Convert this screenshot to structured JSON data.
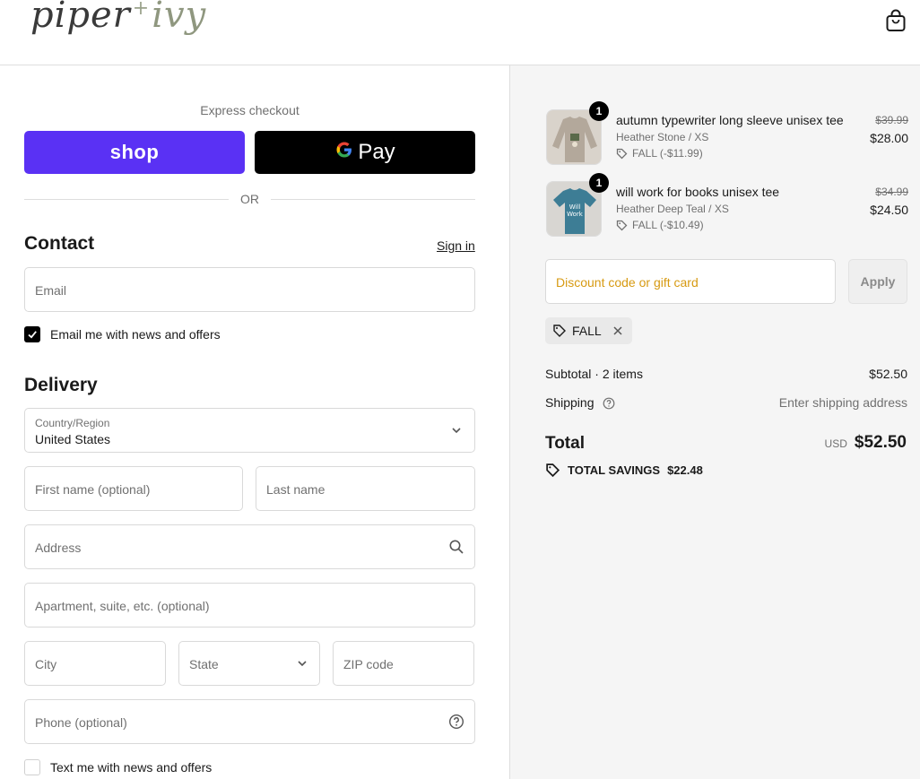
{
  "header": {
    "logo_main": "piper",
    "logo_plus": "+",
    "logo_second": "ivy",
    "cart_icon": "shopping-bag-icon"
  },
  "express": {
    "label": "Express checkout",
    "shop_label": "shop",
    "gpay_g": "G",
    "gpay_label": "Pay",
    "or_label": "OR"
  },
  "contact": {
    "title": "Contact",
    "sign_in": "Sign in",
    "email_placeholder": "Email",
    "newsletter_label": "Email me with news and offers",
    "newsletter_checked": true
  },
  "delivery": {
    "title": "Delivery",
    "country_label": "Country/Region",
    "country_value": "United States",
    "first_name_placeholder": "First name (optional)",
    "last_name_placeholder": "Last name",
    "address_placeholder": "Address",
    "apartment_placeholder": "Apartment, suite, etc. (optional)",
    "city_placeholder": "City",
    "state_placeholder": "State",
    "zip_placeholder": "ZIP code",
    "phone_placeholder": "Phone (optional)",
    "sms_label": "Text me with news and offers",
    "sms_checked": false
  },
  "order": {
    "items": [
      {
        "quantity": "1",
        "title": "autumn typewriter long sleeve unisex tee",
        "variant": "Heather Stone / XS",
        "discount": "FALL (-$11.99)",
        "original_price": "$39.99",
        "price": "$28.00",
        "color": "#b3a89b"
      },
      {
        "quantity": "1",
        "title": "will work for books unisex tee",
        "variant": "Heather Deep Teal / XS",
        "discount": "FALL (-$10.49)",
        "original_price": "$34.99",
        "price": "$24.50",
        "color": "#3d7d95"
      }
    ],
    "discount_placeholder": "Discount code or gift card",
    "apply_label": "Apply",
    "applied_code": "FALL",
    "subtotal_label": "Subtotal · 2 items",
    "subtotal_value": "$52.50",
    "shipping_label": "Shipping",
    "shipping_value": "Enter shipping address",
    "total_label": "Total",
    "currency": "USD",
    "total_value": "$52.50",
    "savings_label": "TOTAL SAVINGS",
    "savings_value": "$22.48"
  },
  "colors": {
    "shop_purple": "#5a31f4",
    "discount_placeholder": "#d79a12",
    "summary_bg": "#f5f5f5"
  }
}
